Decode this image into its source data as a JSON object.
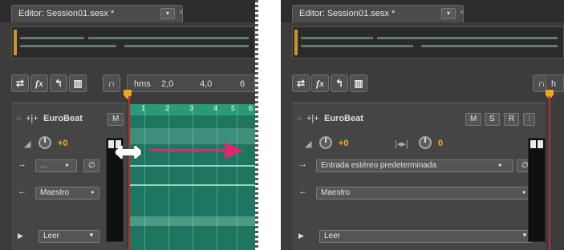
{
  "left": {
    "tab_title": "Editor: Session01.sesx *",
    "tab_menu": "▾",
    "tab_close": "×",
    "ruler_label": "hms",
    "ruler_ticks": [
      "2,0",
      "4,0",
      "6"
    ],
    "clip_markers": [
      "1",
      "2",
      "3",
      "4",
      "5",
      "6"
    ],
    "track_name": "EuroBeat",
    "mute_label": "M",
    "volume_value": "+0",
    "input_value": "...",
    "output_value": "Maestro",
    "automation_value": "Leer"
  },
  "right": {
    "tab_title": "Editor: Session01.sesx *",
    "tab_menu": "▾",
    "tab_close": "×",
    "ruler_label": "h",
    "track_name": "EuroBeat",
    "mute_label": "M",
    "solo_label": "S",
    "arm_label": "R",
    "monitor_label": "I",
    "volume_value": "+0",
    "pan_value": "0",
    "input_value": "Entrada estéreo predeterminada",
    "output_value": "Maestro",
    "automation_value": "Leer"
  },
  "colors": {
    "accent": "#f0b21c",
    "playhead": "#c4292d",
    "clip": "#1f7660",
    "arrow": "#e0266e"
  },
  "icons": {
    "swap": "⇄",
    "fx": "fx",
    "sends": "↰",
    "eq": "▥",
    "headphones": "∩"
  }
}
